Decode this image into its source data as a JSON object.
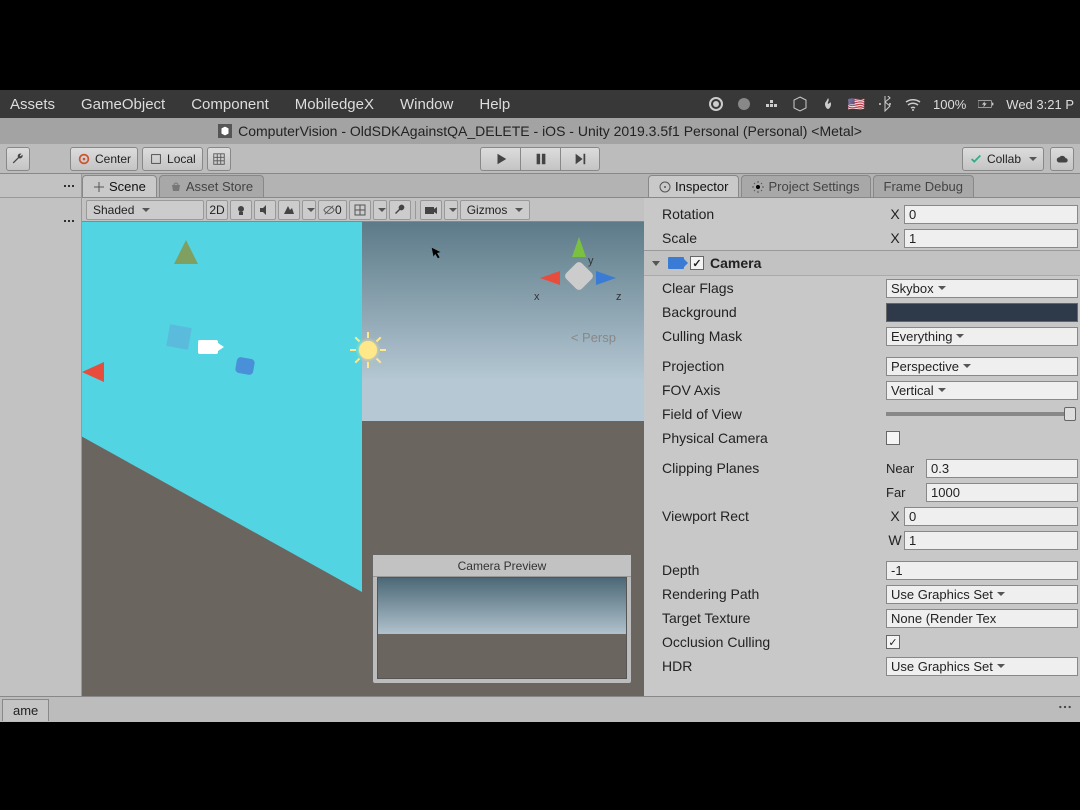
{
  "menubar": {
    "items": [
      "Assets",
      "GameObject",
      "Component",
      "MobiledgeX",
      "Window",
      "Help"
    ],
    "battery": "100%",
    "clock": "Wed 3:21 P"
  },
  "titlebar": "ComputerVision - OldSDKAgainstQA_DELETE - iOS - Unity 2019.3.5f1 Personal (Personal) <Metal>",
  "toolbar": {
    "pivot": "Center",
    "space": "Local",
    "collab": "Collab"
  },
  "scene_tabs": {
    "scene": "Scene",
    "asset_store": "Asset Store"
  },
  "scene_toolbar": {
    "shading": "Shaded",
    "d2": "2D",
    "mask_count": "0",
    "gizmos": "Gizmos"
  },
  "gizmo": {
    "x": "x",
    "y": "y",
    "z": "z",
    "persp": "Persp"
  },
  "camera_preview_title": "Camera Preview",
  "inspector": {
    "tabs": {
      "inspector": "Inspector",
      "project_settings": "Project Settings",
      "frame_debug": "Frame Debug"
    },
    "transform": {
      "rotation_label": "Rotation",
      "rotation_x_axis": "X",
      "rotation_x": "0",
      "scale_label": "Scale",
      "scale_x_axis": "X",
      "scale_x": "1"
    },
    "camera_component": {
      "title": "Camera",
      "clear_flags_label": "Clear Flags",
      "clear_flags": "Skybox",
      "background_label": "Background",
      "culling_mask_label": "Culling Mask",
      "culling_mask": "Everything",
      "projection_label": "Projection",
      "projection": "Perspective",
      "fov_axis_label": "FOV Axis",
      "fov_axis": "Vertical",
      "fov_label": "Field of View",
      "physical_camera_label": "Physical Camera",
      "clipping_label": "Clipping Planes",
      "near_label": "Near",
      "near": "0.3",
      "far_label": "Far",
      "far": "1000",
      "viewport_label": "Viewport Rect",
      "vx_axis": "X",
      "vx": "0",
      "vw_axis": "W",
      "vw": "1",
      "depth_label": "Depth",
      "depth": "-1",
      "rendering_path_label": "Rendering Path",
      "rendering_path": "Use Graphics Set",
      "target_texture_label": "Target Texture",
      "target_texture": "None (Render Tex",
      "occlusion_label": "Occlusion Culling",
      "hdr_label": "HDR",
      "hdr": "Use Graphics Set"
    }
  },
  "bottom_tab": "ame"
}
